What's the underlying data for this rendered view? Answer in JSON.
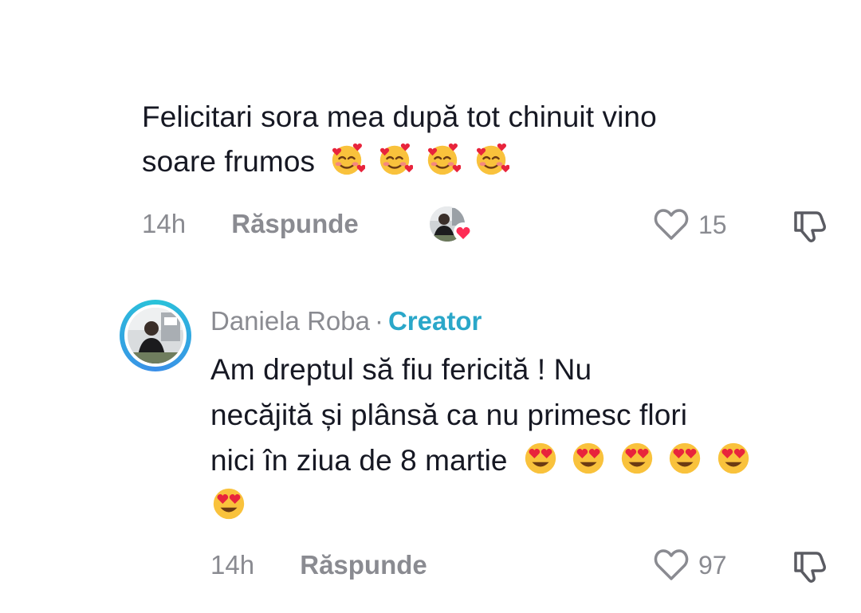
{
  "comments": [
    {
      "text_line1": "Felicitari sora mea după tot chinuit vino",
      "text_line2": "soare frumos",
      "emoji": "smiling-face-with-hearts-icon",
      "emoji_count": 4,
      "time": "14h",
      "reply_label": "Răspunde",
      "creator_liked": true,
      "likes": "15"
    },
    {
      "author": "Daniela Roba",
      "separator": "·",
      "badge": "Creator",
      "text_line1": "Am dreptul să fiu fericită ! Nu",
      "text_line2": "necăjită și plânsă ca nu primesc flori",
      "text_line3": "nici în ziua de 8 martie",
      "emoji": "heart-eyes-icon",
      "emoji_count": 6,
      "time": "14h",
      "reply_label": "Răspunde",
      "likes": "97"
    }
  ],
  "colors": {
    "text": "#161823",
    "meta": "#8a8b91",
    "creator_badge": "#2aa7c9",
    "heart_badge": "#fe2c55"
  }
}
